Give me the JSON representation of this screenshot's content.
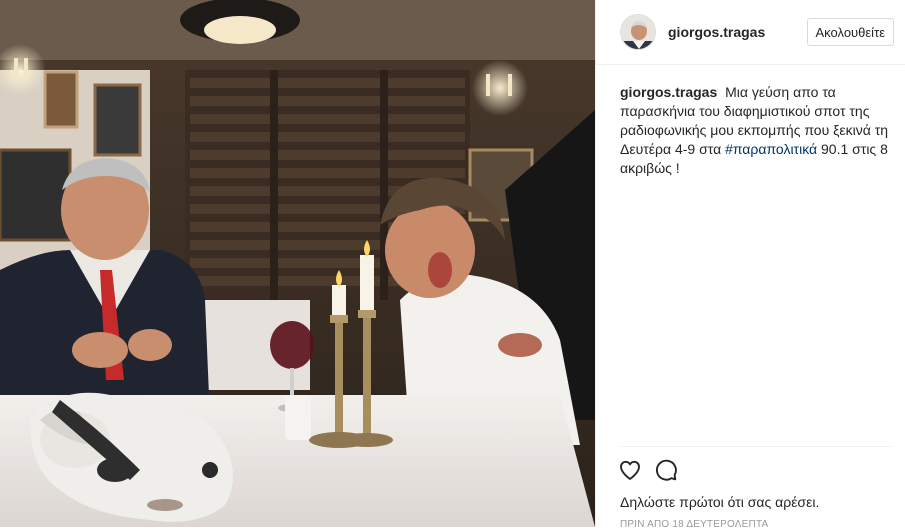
{
  "post": {
    "username": "giorgos.tragas",
    "follow_label": "Ακολουθείτε",
    "caption": {
      "username": "giorgos.tragas",
      "text_before": "Μια γεύση απο τα παρασκήνια του διαφημιστικού σποτ της ραδιοφωνικής μου εκπομπής που ξεκινά τη Δευτέρα 4-9 στα",
      "hashtag": "#παραπολιτικά",
      "text_after": "90.1 στις 8 ακριβώς !"
    },
    "likes": {
      "prefix": "Δηλώστε πρώτοι ότι",
      "link": "σας αρέσει",
      "suffix": "."
    },
    "timestamp": "ΠΡΙΝ ΑΠΟ 18 ΔΕΥΤΕΡΟΛΕΠΤΑ",
    "icons": {
      "like": "heart-icon",
      "comment": "comment-icon"
    }
  },
  "colors": {
    "text": "#262626",
    "hashtag": "#003569",
    "border": "#dbdbdb",
    "muted": "#999999"
  }
}
